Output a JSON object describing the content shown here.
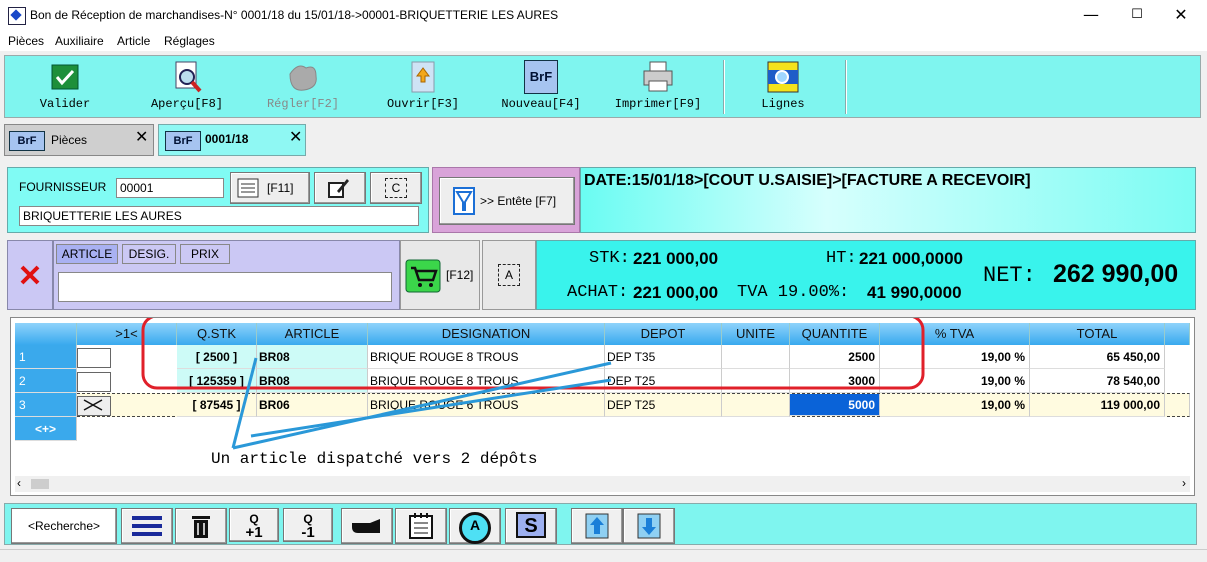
{
  "window": {
    "title": "Bon de Réception de marchandises-N° 0001/18 du 15/01/18->00001-BRIQUETTERIE LES AURES",
    "min": "—",
    "max": "☐",
    "close": "✕"
  },
  "menu": [
    "Pièces",
    "Auxiliaire",
    "Article",
    "Réglages"
  ],
  "toolbar": [
    {
      "label": "Valider",
      "icon": "validate-icon"
    },
    {
      "label": "Aperçu[F8]",
      "icon": "preview-icon"
    },
    {
      "label": "Régler[F2]",
      "icon": "payment-icon"
    },
    {
      "label": "Ouvrir[F3]",
      "icon": "open-icon"
    },
    {
      "label": "Nouveau[F4]",
      "icon": "new-icon"
    },
    {
      "label": "Imprimer[F9]",
      "icon": "printer-icon"
    },
    {
      "label": "Lignes",
      "icon": "lines-icon"
    }
  ],
  "tabs": [
    {
      "icon_text": "BrF",
      "label": "Pièces",
      "close": "✕"
    },
    {
      "icon_text": "BrF",
      "label": "0001/18",
      "close": "✕"
    }
  ],
  "supplier": {
    "label": "FOURNISSEUR",
    "code": "00001",
    "name": "BRIQUETTERIE LES AURES",
    "f11": "[F11]",
    "c_icon_text": "C"
  },
  "entete": {
    "label": ">> Entête [F7]"
  },
  "date_info": "DATE:15/01/18>[COUT U.SAISIE]>[FACTURE A RECEVOIR]",
  "article_search": {
    "chips": [
      "ARTICLE",
      "DESIG.",
      "PRIX"
    ],
    "value": "",
    "f12": "[F12]",
    "a_icon_text": "A"
  },
  "totals": {
    "stk_label": "STK:",
    "stk_value": "221 000,00",
    "ht_label": "HT:",
    "ht_value": "221 000,0000",
    "achat_label": "ACHAT:",
    "achat_value": "221 000,00",
    "tva_label": "TVA 19.00%:",
    "tva_value": "41 990,0000",
    "net_label": "NET:",
    "net_value": "262 990,00"
  },
  "grid": {
    "headers": [
      "",
      ">1<",
      "Q.STK",
      "ARTICLE",
      "DESIGNATION",
      "DEPOT",
      "UNITE",
      "QUANTITE",
      "% TVA",
      "TOTAL"
    ],
    "rows": [
      {
        "n": "1",
        "qstk": "[ 2500 ]",
        "article": "BR08",
        "designation": "BRIQUE ROUGE 8 TROUS",
        "depot": "DEP T35",
        "unite": "",
        "quantite": "2500",
        "tva": "19,00 %",
        "total": "65 450,00"
      },
      {
        "n": "2",
        "qstk": "[ 125359 ]",
        "article": "BR08",
        "designation": "BRIQUE ROUGE 8 TROUS",
        "depot": "DEP T25",
        "unite": "",
        "quantite": "3000",
        "tva": "19,00 %",
        "total": "78 540,00"
      },
      {
        "n": "3",
        "qstk": "[ 87545 ]",
        "article": "BR06",
        "designation": "BRIQUE ROUGE 6 TROUS",
        "depot": "DEP T25",
        "unite": "",
        "quantite": "5000",
        "tva": "19,00 %",
        "total": "119 000,00"
      }
    ],
    "add_row": "<+>",
    "annotation": "Un article dispatché vers 2 dépôts"
  },
  "bottom": {
    "search": "<Recherche>",
    "q_plus": "Q +1",
    "q_minus": "Q -1",
    "a_text": "A",
    "s_text": "S"
  }
}
